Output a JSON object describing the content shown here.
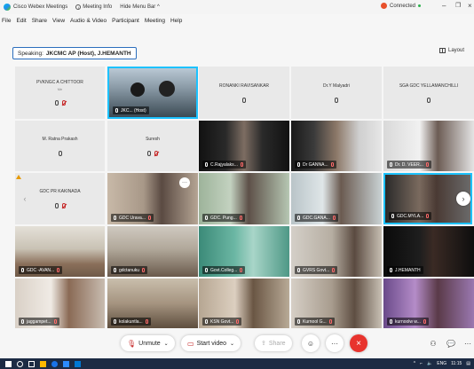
{
  "titlebar": {
    "app_name": "Cisco Webex Meetings",
    "meeting_info": "Meeting Info",
    "hide_menu": "Hide Menu Bar ^",
    "connected": "Connected",
    "min": "–",
    "max": "❐",
    "close": "×"
  },
  "menu": [
    "File",
    "Edit",
    "Share",
    "View",
    "Audio & Video",
    "Participant",
    "Meeting",
    "Help"
  ],
  "speaking": {
    "prefix": "Speaking:",
    "name": "JKCMC AP (Host), J.HEMANTH"
  },
  "layout_label": "Layout",
  "name_tiles": [
    {
      "name": "PVKNGC A CHITTOOR",
      "sub": "Me"
    },
    {
      "name": "RONANKI RAVISANKAR",
      "sub": ""
    },
    {
      "name": "Dr.Y Malyadri",
      "sub": ""
    },
    {
      "name": "SGA GDC YELLAMANCHILLI",
      "sub": ""
    },
    {
      "name": "M. Ratna Prakash",
      "sub": ""
    },
    {
      "name": "Suresh",
      "sub": ""
    },
    {
      "name": "GDC PR KAKINADA",
      "sub": ""
    }
  ],
  "video_labels": [
    "JKC... (Host)",
    "C.Rajyalaks...",
    "Dr GANNA...",
    "Dr. D. VEER...",
    "GDC Urava...",
    "GDC. Pung...",
    "GDC.GANA...",
    "GDC.MYLA...",
    "GDC -AVAN...",
    "gdctanuku",
    "Govt.Colleg...",
    "GVRS Govt...",
    "J.HEMANTH",
    "jaggampet...",
    "kolakuntla...",
    "KSN Govt...",
    "Kurnool G...",
    "kurnoolw w..."
  ],
  "controls": {
    "unmute": "Unmute",
    "start_video": "Start video",
    "share": "Share",
    "more": "···",
    "leave": "×"
  },
  "taskbar": {
    "lang": "ENG",
    "time": "11:15"
  },
  "colors": {
    "accent": "#1cc2ff",
    "leave": "#e8332d",
    "muted": "#c62828",
    "taskbar": "#1c2b44"
  }
}
